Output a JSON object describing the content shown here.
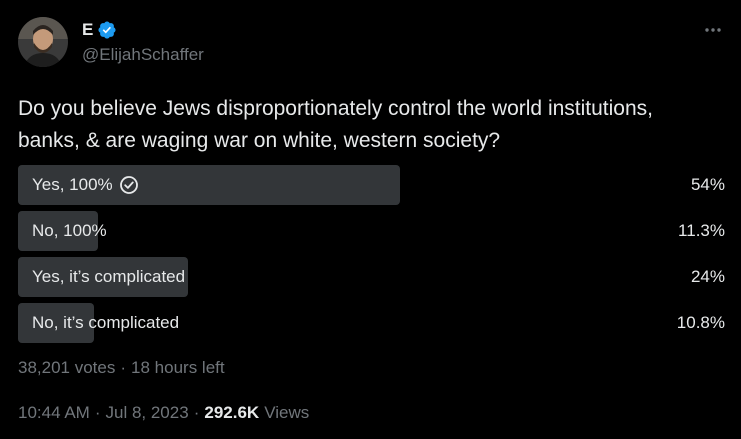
{
  "author": {
    "display_name": "E",
    "handle": "@ElijahSchaffer",
    "verified": true,
    "avatar_icon": "user-avatar"
  },
  "menu": {
    "more_icon": "more-horizontal-icon"
  },
  "tweet": {
    "text": "Do you believe Jews disproportionately control the world institutions, banks, & are waging war on white, western society?"
  },
  "poll": {
    "options": [
      {
        "label": "Yes, 100%",
        "percent_text": "54%",
        "percent": 54,
        "winner": true
      },
      {
        "label": "No, 100%",
        "percent_text": "11.3%",
        "percent": 11.3,
        "winner": false
      },
      {
        "label": "Yes, it’s complicated",
        "percent_text": "24%",
        "percent": 24,
        "winner": false
      },
      {
        "label": "No, it’s complicated",
        "percent_text": "10.8%",
        "percent": 10.8,
        "winner": false
      }
    ],
    "votes": "38,201 votes",
    "separator": "·",
    "time_left": "18 hours left"
  },
  "meta": {
    "time": "10:44 AM",
    "separator": "·",
    "date": "Jul 8, 2023",
    "views_count": "292.6K",
    "views_label": "Views"
  },
  "colors": {
    "background": "#000000",
    "text": "#e7e9ea",
    "secondary_text": "#71767b",
    "poll_bar": "#333639",
    "verified_blue": "#1d9bf0"
  }
}
